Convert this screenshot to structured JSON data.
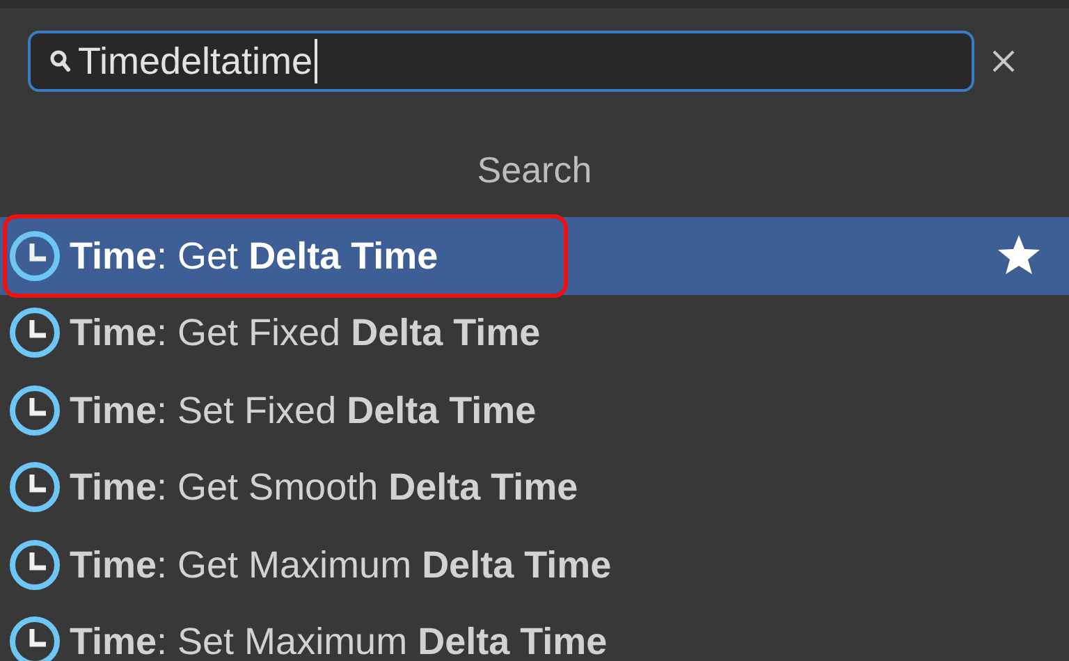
{
  "search": {
    "value": "Timedeltatime"
  },
  "section_title": "Search",
  "results": [
    {
      "label": "**Time**: Get **Delta Time**",
      "selected": true,
      "outlined": true
    },
    {
      "label": "**Time**: Get Fixed **Delta Time**",
      "selected": false,
      "outlined": false
    },
    {
      "label": "**Time**: Set Fixed **Delta Time**",
      "selected": false,
      "outlined": false
    },
    {
      "label": "**Time**: Get Smooth **Delta Time**",
      "selected": false,
      "outlined": false
    },
    {
      "label": "**Time**: Get Maximum **Delta Time**",
      "selected": false,
      "outlined": false
    },
    {
      "label": "**Time**: Set Maximum **Delta Time**",
      "selected": false,
      "outlined": false
    }
  ]
}
